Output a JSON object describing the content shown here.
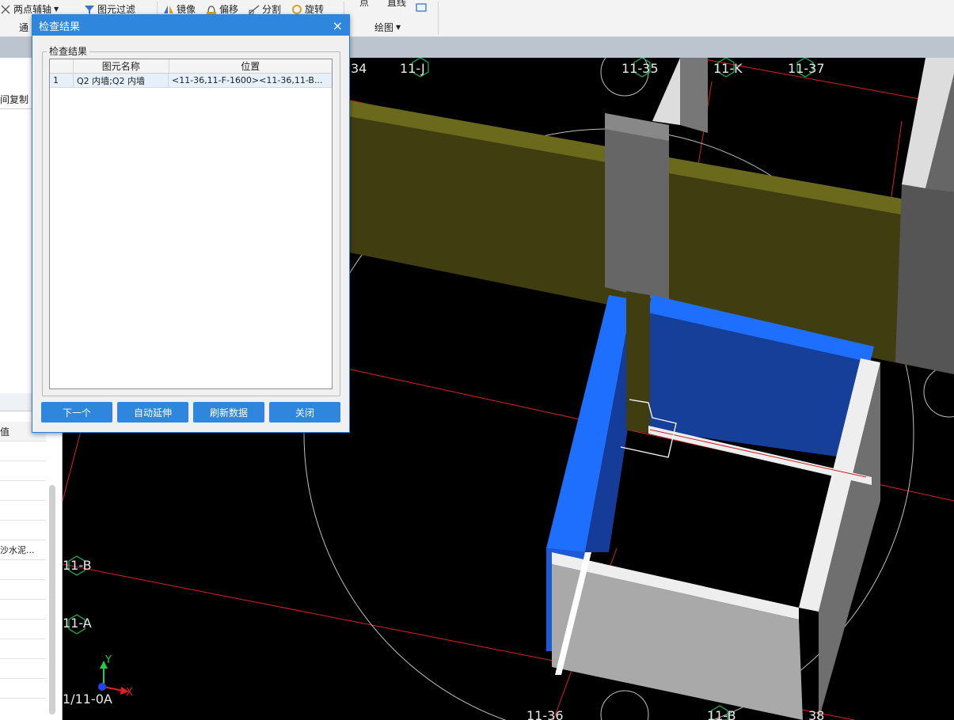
{
  "ribbon": {
    "two_point_axis": "两点辅轴",
    "element_filter": "图元过滤",
    "mirror": "镜像",
    "offset": "偏移",
    "split": "分割",
    "rotate": "旋转",
    "general_partial": "通",
    "point": "点",
    "line": "直线",
    "draw_group": "绘图"
  },
  "left_panel": {
    "copy_label": "间复制",
    "value_header": "值",
    "material_value": "沙水泥..."
  },
  "dialog": {
    "title": "检查结果",
    "close_symbol": "×",
    "group_label": "检查结果",
    "columns": [
      "",
      "图元名称",
      "位置"
    ],
    "rows": [
      {
        "index": "1",
        "name": "Q2 内墙;Q2 内墙",
        "position": "<11-36,11-F-1600><11-36,11-B..."
      }
    ],
    "buttons": {
      "next": "下一个",
      "auto_extend": "自动延伸",
      "refresh": "刷新数据",
      "close": "关闭"
    }
  },
  "viewport": {
    "axis_labels": {
      "a34": "34",
      "j": "11-J",
      "a35": "11-35",
      "k": "11-K",
      "a37": "11-37",
      "b_left": "11-B",
      "a_left": "11-A",
      "origin": "1/11-0A",
      "a36_bottom": "11-36",
      "b_bottom": "11-B",
      "a38_bottom": "38"
    },
    "axis_x": "X",
    "axis_y": "Y"
  },
  "colors": {
    "accent": "#2f86dd",
    "wall_blue": "#1f6fff",
    "beam_olive": "#3f3d10"
  }
}
